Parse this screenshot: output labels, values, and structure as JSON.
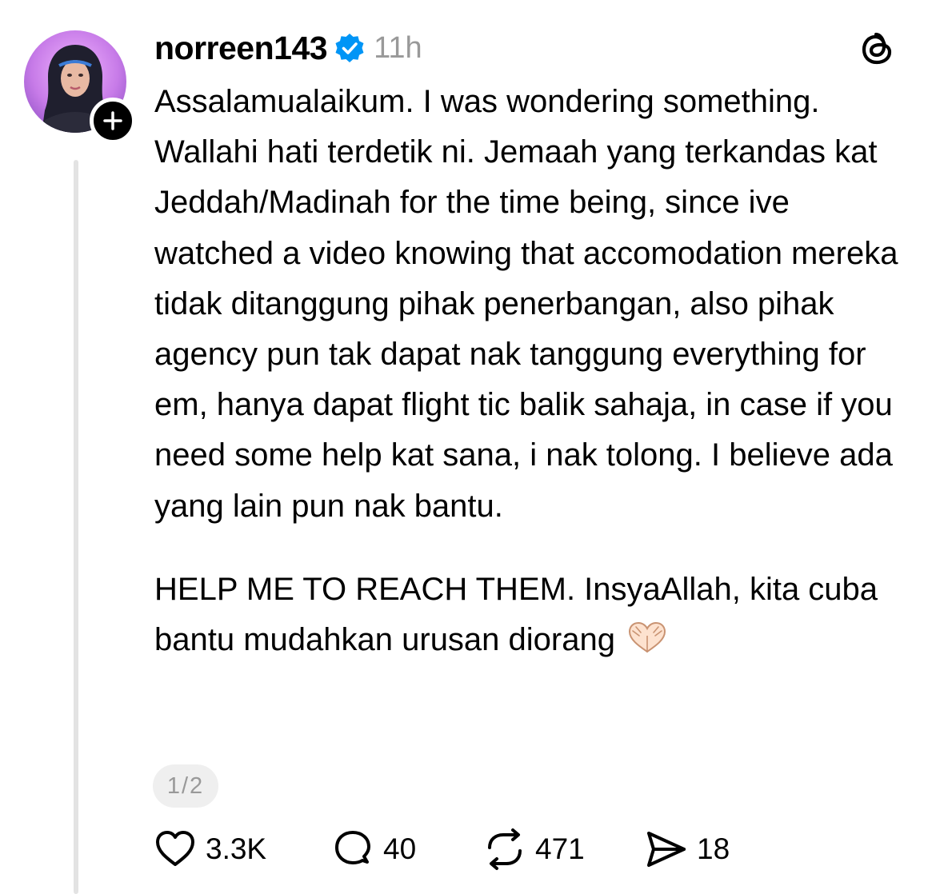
{
  "post": {
    "author": {
      "username": "norreen143",
      "verified": true,
      "time_ago": "11h"
    },
    "text_paragraphs": [
      "Assalamualaikum. I was wondering something. Wallahi hati terdetik ni. Jemaah yang terkandas kat Jeddah/Madinah for the time being, since ive watched a video knowing that accomodation mereka tidak ditanggung pihak penerbangan, also pihak agency pun tak dapat nak tanggung everything for em, hanya dapat flight tic balik sahaja, in case if you need some help kat sana, i nak tolong. I believe ada yang lain pun nak bantu.",
      "HELP ME TO REACH THEM. InsyaAllah, kita cuba bantu mudahkan urusan diorang"
    ],
    "emoji": "heart-hands",
    "pager": "1/2",
    "actions": {
      "likes": "3.3K",
      "replies": "40",
      "reposts": "471",
      "shares": "18"
    }
  },
  "colors": {
    "text": "#000000",
    "muted": "#999999",
    "verified_blue": "#0095f6",
    "thread_line": "#e3e3e3",
    "pager_bg": "#efefef"
  },
  "icons": {
    "verified": "verified-badge-icon",
    "threads": "threads-logo-icon",
    "follow": "plus-icon",
    "like": "heart-icon",
    "reply": "comment-icon",
    "repost": "repost-icon",
    "share": "send-icon"
  }
}
